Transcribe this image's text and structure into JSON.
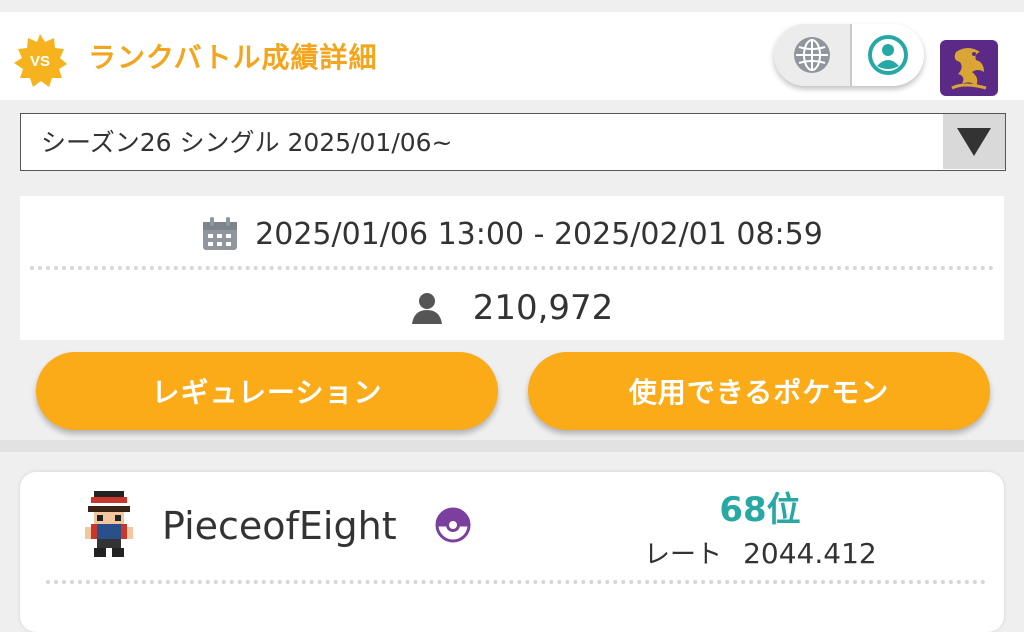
{
  "header": {
    "badge_text": "VS",
    "title": "ランクバトル成績詳細",
    "accent_color": "#f3a51d",
    "globe_icon": "globe-icon",
    "user_icon": "user-circle-icon",
    "avatar_icon": "dragon-avatar-icon"
  },
  "season_select": {
    "selected": "シーズン26 シングル 2025/01/06~"
  },
  "season_info": {
    "period": "2025/01/06 13:00 - 2025/02/01 08:59",
    "players": "210,972"
  },
  "buttons": {
    "regulation": "レギュレーション",
    "usable_pokemon": "使用できるポケモン",
    "color": "#fbaa18"
  },
  "ranking": {
    "player_name": "PieceofEight",
    "rank": "68位",
    "rate_label": "レート",
    "rate_value": "2044.412",
    "rank_color": "#26a9a4"
  }
}
